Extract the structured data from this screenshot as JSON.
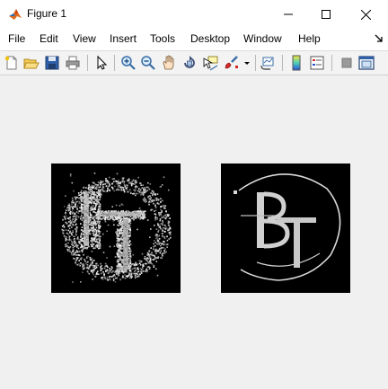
{
  "window": {
    "title": "Figure 1",
    "controls": [
      "minimize-icon",
      "maximize-icon",
      "close-icon"
    ]
  },
  "menu": {
    "items": [
      "File",
      "Edit",
      "View",
      "Insert",
      "Tools",
      "Desktop",
      "Window",
      "Help"
    ]
  },
  "toolbar": {
    "icons": [
      "new-figure-icon",
      "open-file-icon",
      "save-icon",
      "print-icon",
      "edit-plot-icon",
      "zoom-in-icon",
      "zoom-out-icon",
      "pan-icon",
      "rotate-3d-icon",
      "data-cursor-icon",
      "brush-icon",
      "brush-dropdown-icon",
      "link-plot-icon",
      "insert-colorbar-icon",
      "insert-legend-icon",
      "hide-plot-tools-icon",
      "show-plot-tools-icon"
    ]
  },
  "figure": {
    "background": "#f0f0f0",
    "axes_background": "#000000",
    "images": [
      {
        "name": "noisy-logo",
        "letters": "BT"
      },
      {
        "name": "clean-logo",
        "letters": "BT"
      }
    ]
  }
}
